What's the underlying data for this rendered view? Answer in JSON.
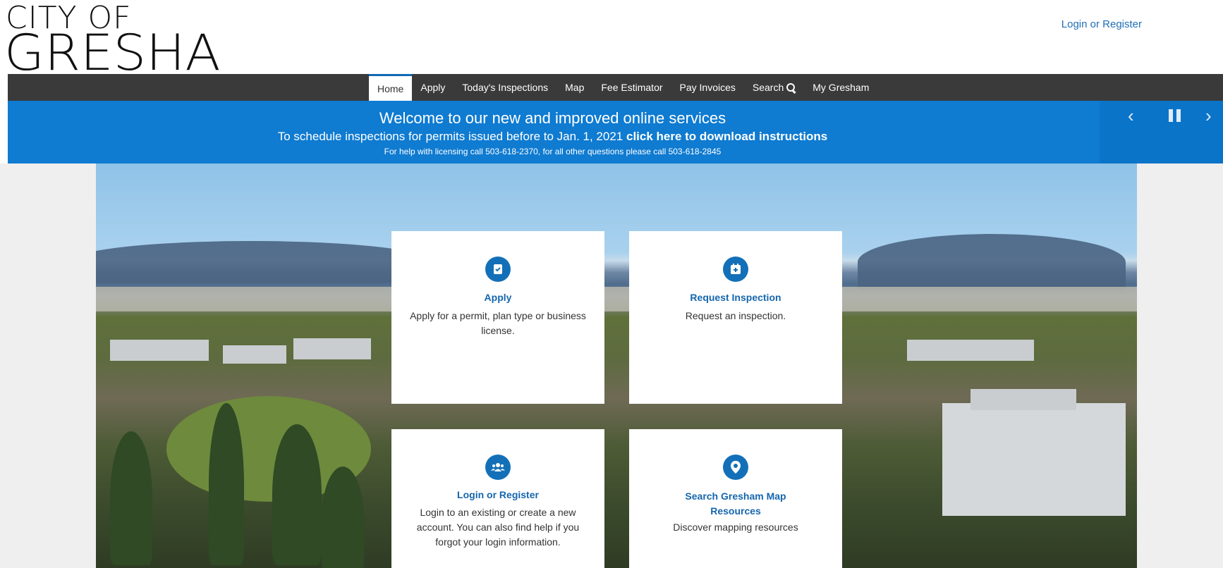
{
  "header": {
    "logo_line1": "CITY OF",
    "logo_line2": "GRESHAM",
    "login_link": "Login or Register"
  },
  "nav": {
    "items": [
      {
        "label": "Home",
        "active": true
      },
      {
        "label": "Apply"
      },
      {
        "label": "Today's Inspections"
      },
      {
        "label": "Map"
      },
      {
        "label": "Fee Estimator"
      },
      {
        "label": "Pay Invoices"
      },
      {
        "label": "Search",
        "icon": "search-icon"
      },
      {
        "label": "My Gresham"
      }
    ]
  },
  "banner": {
    "title": "Welcome to our new and improved online services",
    "line2_prefix": "To schedule inspections for permits issued before to Jan. 1, 2021 ",
    "line2_link": "click here to download instructions",
    "line3": "For help with licensing call 503-618-2370, for all other questions please call 503-618-2845",
    "controls": [
      "chevron-left-icon",
      "pause-icon",
      "chevron-right-icon"
    ]
  },
  "cards": [
    {
      "title": "Apply",
      "desc": "Apply for a permit, plan type or business license.",
      "icon": "clipboard-check-icon"
    },
    {
      "title": "Request Inspection",
      "desc": "Request an inspection.",
      "icon": "calendar-plus-icon"
    },
    {
      "title": "Login or Register",
      "desc": "Login to an existing or create a new account. You can also find help if you forgot your login information.",
      "icon": "users-icon"
    },
    {
      "title": "Search Gresham Map Resources",
      "desc": "Discover mapping resources",
      "icon": "map-pin-icon"
    }
  ],
  "colors": {
    "nav_bg": "#3a3a3a",
    "banner_bg": "#0f7bd1",
    "link": "#1f6fb5",
    "accent": "#1370b8"
  }
}
